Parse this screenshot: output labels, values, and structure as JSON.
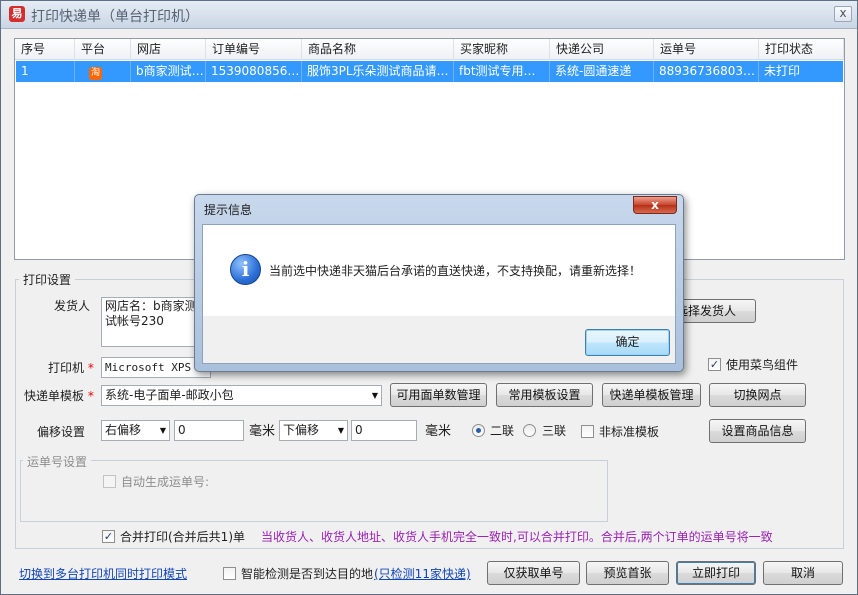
{
  "window": {
    "title": "打印快递单（单台打印机）",
    "app_icon": "易",
    "close": "x"
  },
  "grid": {
    "headers": [
      "序号",
      "平台",
      "网店",
      "订单编号",
      "商品名称",
      "买家昵称",
      "快递公司",
      "运单号",
      "打印状态"
    ],
    "rows": [
      {
        "index": "1",
        "platform_icon": "淘",
        "shop": "b商家测试…",
        "order_no": "1539080856…",
        "product": "服饰3PL乐朵测试商品请…",
        "buyer": "fbt测试专用…",
        "courier": "系统-圆通速递",
        "waybill": "889367368038…",
        "status": "未打印"
      }
    ]
  },
  "print_settings": {
    "group_title": "打印设置",
    "sender_label": "发货人",
    "sender_value_line1": "网店名：b商家测",
    "sender_value_line2": "试帐号230",
    "select_sender_button": "选择发货人",
    "printer_label": "打印机",
    "required_mark": "*",
    "printer_value": "Microsoft XPS D",
    "use_cainiao_label": "使用菜鸟组件",
    "use_cainiao_checked": true,
    "template_label": "快递单模板",
    "template_value": "系统-电子面单-邮政小包",
    "btn_available_count": "可用面单数管理",
    "btn_common_template": "常用模板设置",
    "btn_template_manage": "快递单模板管理",
    "btn_switch_outlet": "切换网点",
    "offset_label": "偏移设置",
    "offset_h_value": "右偏移",
    "offset_h_amount": "0",
    "unit_mm": "毫米",
    "offset_v_value": "下偏移",
    "offset_v_amount": "0",
    "unit_mm2": "毫米",
    "radio_two": "二联",
    "radio_three": "三联",
    "nonstandard_label": "非标准模板",
    "btn_product_info": "设置商品信息",
    "waybill_group_title": "运单号设置",
    "auto_waybill_label": "自动生成运单号:",
    "merge_label": "合并打印(合并后共1)单",
    "merge_checked": true,
    "merge_hint": "当收货人、收货人地址、收货人手机完全一致时,可以合并打印。合并后,两个订单的运单号将一致"
  },
  "footer": {
    "switch_link": "切换到多台打印机同时打印模式",
    "smart_check_label": "智能检测是否到达目的地",
    "smart_check_link": "(只检测11家快递)",
    "btn_fetch_only": "仅获取单号",
    "btn_preview": "预览首张",
    "btn_print_now": "立即打印",
    "btn_cancel": "取消"
  },
  "dialog": {
    "title": "提示信息",
    "close": "x",
    "icon": "i",
    "message": "当前选中快递非天猫后台承诺的直送快递，不支持换配，请重新选择！",
    "ok": "确定"
  }
}
